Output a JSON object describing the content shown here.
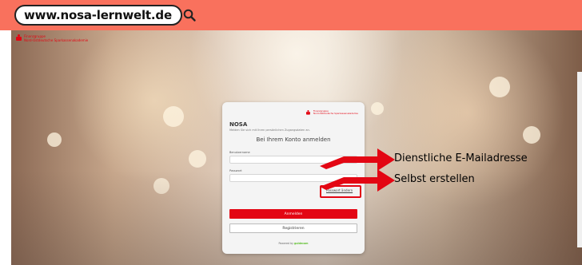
{
  "banner": {
    "url": "www.nosa-lernwelt.de",
    "search_icon": "search-icon",
    "color": "#f9715d"
  },
  "org": {
    "name_line1": "Finanzgruppe",
    "name_line2": "Nord-Ostdeutsche Sparkassenakademie",
    "brand_color": "#e30613"
  },
  "login_card": {
    "app_name": "NOSA",
    "subtitle": "Melden Sie sich mit Ihren persönlichen Zugangsdaten an.",
    "heading": "Bei Ihrem Konto anmelden",
    "username_label": "Benutzername",
    "username_value": "",
    "password_label": "Passwort",
    "password_value": "",
    "reset_link": "Passwort ändern",
    "login_button": "Anmelden",
    "register_button": "Registrieren",
    "powered_by": "Powered by",
    "powered_brand": "guidecom"
  },
  "annotations": {
    "email_hint": "Dienstliche E-Mailadresse",
    "password_hint": "Selbst erstellen",
    "arrow_color": "#e30613"
  }
}
